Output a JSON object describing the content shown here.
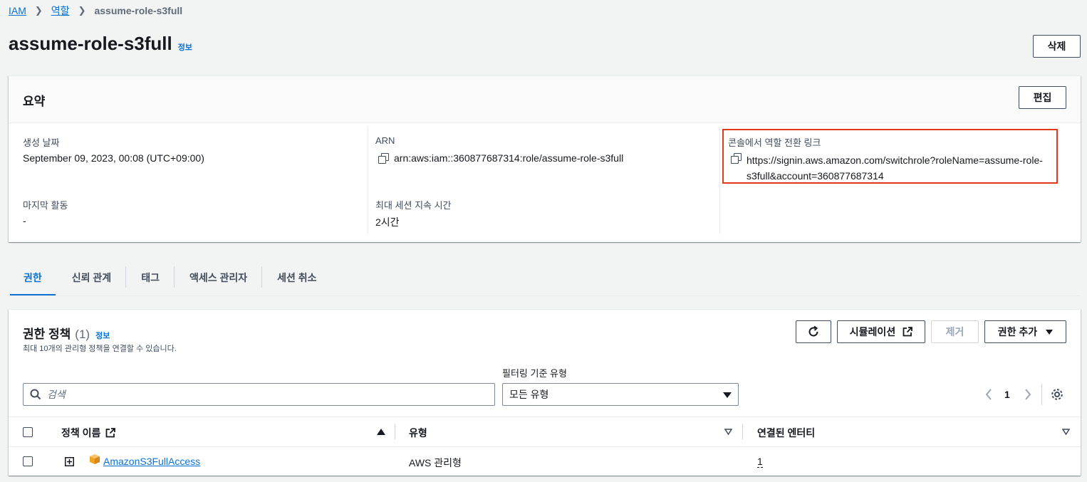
{
  "breadcrumb": {
    "items": [
      "IAM",
      "역할"
    ],
    "current": "assume-role-s3full"
  },
  "page": {
    "title": "assume-role-s3full",
    "info_label": "정보",
    "delete_label": "삭제"
  },
  "summary": {
    "title": "요약",
    "edit_label": "편집",
    "created_label": "생성 날짜",
    "created_value": "September 09, 2023, 00:08 (UTC+09:00)",
    "last_activity_label": "마지막 활동",
    "last_activity_value": "-",
    "arn_label": "ARN",
    "arn_value": "arn:aws:iam::360877687314:role/assume-role-s3full",
    "max_session_label": "최대 세션 지속 시간",
    "max_session_value": "2시간",
    "switch_link_label": "콘솔에서 역할 전환 링크",
    "switch_link_line1": "https://signin.aws.amazon.com/switchrole?roleName=assume-role-",
    "switch_link_line2": "s3full&account=360877687314"
  },
  "tabs": [
    "권한",
    "신뢰 관계",
    "태그",
    "액세스 관리자",
    "세션 취소"
  ],
  "policies": {
    "title": "권한 정책",
    "count": "(1)",
    "info_label": "정보",
    "subtitle": "최대 10개의 관리형 정책을 연결할 수 있습니다.",
    "simulate_label": "시뮬레이션",
    "remove_label": "제거",
    "add_label": "권한 추가",
    "search_placeholder": "검색",
    "filter_label": "필터링 기준 유형",
    "filter_value": "모든 유형",
    "page_number": "1",
    "columns": {
      "name": "정책 이름",
      "type": "유형",
      "attached": "연결된 엔터티"
    },
    "rows": [
      {
        "name": "AmazonS3FullAccess",
        "type": "AWS 관리형",
        "attached": "1"
      }
    ]
  },
  "colors": {
    "link": "#0972d3",
    "highlight": "#e0391c",
    "background": "#f2f3f3",
    "s3_icon": "#f3a322"
  }
}
